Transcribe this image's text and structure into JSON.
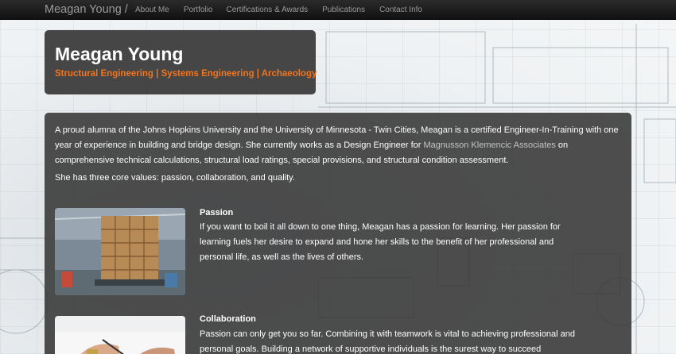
{
  "navbar": {
    "brand": "Meagan Young /",
    "links": [
      "About Me",
      "Portfolio",
      "Certifications & Awards",
      "Publications",
      "Contact Info"
    ]
  },
  "hero": {
    "title": "Meagan Young",
    "subtitle": "Structural Engineering | Systems Engineering | Archaeology"
  },
  "intro": {
    "part1": "A proud alumna of the Johns Hopkins University and the University of Minnesota - Twin Cities, Meagan is a certified Engineer-In-Training with one year of experience in building and bridge design. She currently works as a Design Engineer for ",
    "link": "Magnusson Klemencic Associates",
    "part2": " on comprehensive technical calculations, structural load ratings, special provisions, and structural condition assessment.",
    "values": "She has three core values: passion, collaboration, and quality."
  },
  "features": [
    {
      "title": "Passion",
      "text": "If you want to boil it all down to one thing, Meagan has a passion for learning. Her passion for learning fuels her desire to expand and hone her skills to the benefit of her professional and personal life, as well as the lives of others."
    },
    {
      "title": "Collaboration",
      "text": "Passion can only get you so far. Combining it with teamwork is vital to achieving professional and personal goals. Building a network of supportive individuals is the surest way to succeed"
    }
  ],
  "colors": {
    "accent": "#f0751e",
    "navbar": "#1b1b1b",
    "card": "#323232"
  }
}
